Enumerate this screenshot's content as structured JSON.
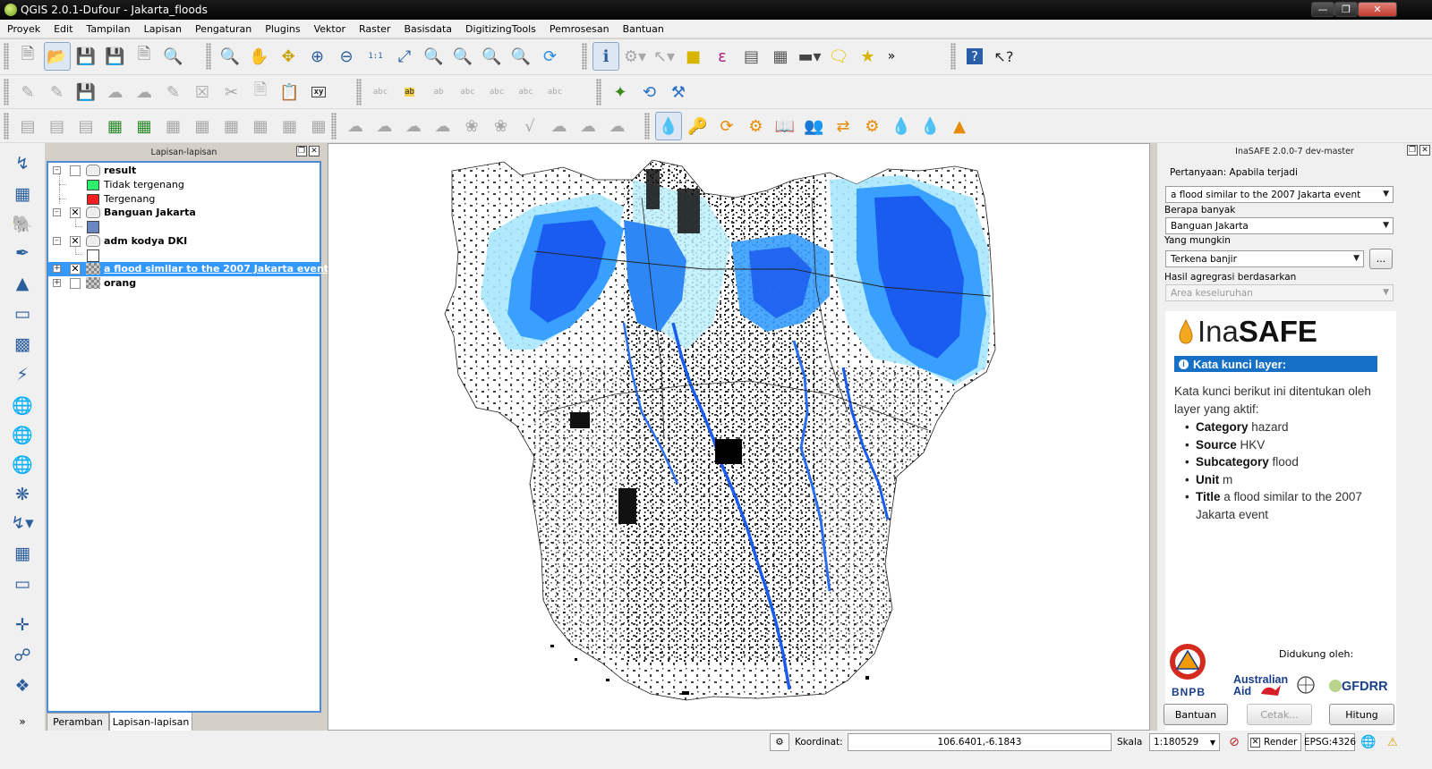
{
  "window": {
    "title": "QGIS 2.0.1-Dufour - Jakarta_floods"
  },
  "menu": [
    "Proyek",
    "Edit",
    "Tampilan",
    "Lapisan",
    "Pengaturan",
    "Plugins",
    "Vektor",
    "Raster",
    "Basisdata",
    "DigitizingTools",
    "Pemrosesan",
    "Bantuan"
  ],
  "toolbar": {
    "overflow_label": "»",
    "coord_button_label": "xy"
  },
  "layers_panel": {
    "title": "Lapisan-lapisan",
    "layers": [
      {
        "name": "result",
        "checked": false,
        "expanded": true,
        "type": "polygon"
      },
      {
        "name": "Tidak tergenang",
        "legend": true,
        "color": "#2bf06a"
      },
      {
        "name": "Tergenang",
        "legend": true,
        "color": "#f01e1e"
      },
      {
        "name": "Banguan Jakarta",
        "checked": true,
        "expanded": true,
        "type": "polygon"
      },
      {
        "name": "",
        "legend": true,
        "color": "#6a86c0"
      },
      {
        "name": "adm kodya DKI",
        "checked": true,
        "expanded": true,
        "type": "polygon"
      },
      {
        "name": "",
        "legend": true,
        "color": "#ffffff"
      },
      {
        "name": "a flood similar to the 2007 Jakarta event",
        "checked": true,
        "expanded": false,
        "selected": true,
        "type": "raster"
      },
      {
        "name": "orang",
        "checked": false,
        "expanded": false,
        "type": "raster"
      }
    ],
    "tabs": [
      "Peramban",
      "Lapisan-lapisan"
    ]
  },
  "inasafe": {
    "title": "InaSAFE 2.0.0-7 dev-master",
    "group_title": "Pertanyaan: Apabila terjadi",
    "hazard_value": "a flood similar to the 2007 Jakarta event",
    "exposure_label": "Berapa banyak",
    "exposure_value": "Banguan Jakarta",
    "function_label": "Yang mungkin",
    "function_value": "Terkena banjir",
    "function_more": "...",
    "aggregation_label": "Hasil agregrasi berdasarkan",
    "aggregation_value": "Area keseluruhan",
    "logo_ina": "Ina",
    "logo_safe": "SAFE",
    "keywords_title": "Kata kunci layer:",
    "keywords_intro": "Kata kunci berikut ini ditentukan oleh layer yang aktif:",
    "keywords": [
      {
        "key": "Category",
        "value": "hazard"
      },
      {
        "key": "Source",
        "value": "HKV"
      },
      {
        "key": "Subcategory",
        "value": "flood"
      },
      {
        "key": "Unit",
        "value": "m"
      },
      {
        "key": "Title",
        "value": "a flood similar to the 2007 Jakarta event"
      }
    ],
    "supported_by": "Didukung oleh:",
    "sponsors": {
      "bnpb": "BNPB",
      "aus1": "Australian",
      "aus2": "Aid",
      "gfdrr": "GFDRR"
    },
    "buttons": {
      "help": "Bantuan",
      "print": "Cetak...",
      "run": "Hitung"
    }
  },
  "status": {
    "coord_label": "Koordinat:",
    "coord_value": "106.6401,-6.1843",
    "scale_label": "Skala",
    "scale_value": "1:180529",
    "render_label": "Render",
    "crs": "EPSG:4326"
  },
  "colors": {
    "flood_deep": "#1a5cf0",
    "flood_mid": "#3aa0ff",
    "flood_light": "#a8e8ff",
    "buildings": "#000000",
    "selection": "#3399ff"
  }
}
